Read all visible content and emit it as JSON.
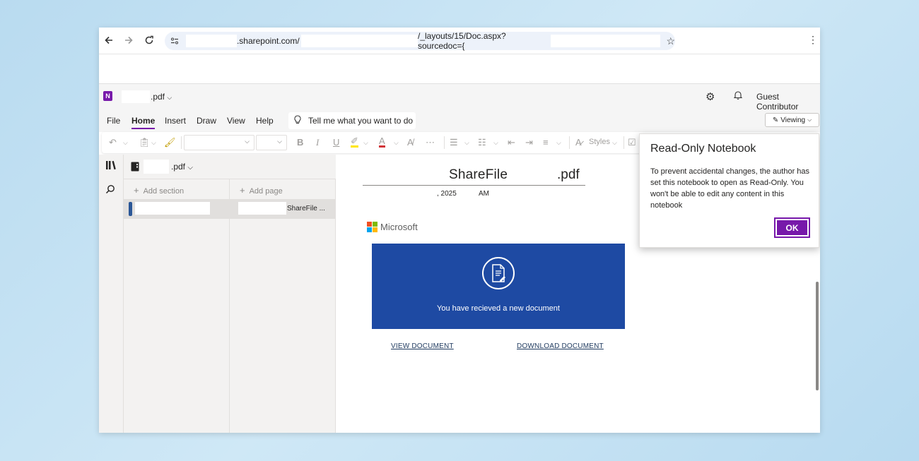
{
  "browser": {
    "url_domain": ".sharepoint.com/",
    "url_path": "/_layouts/15/Doc.aspx?sourcedoc={"
  },
  "app": {
    "logo_letter": "N",
    "doc_title": ".pdf",
    "user": "Guest Contributor"
  },
  "menu": {
    "tabs": [
      "File",
      "Home",
      "Insert",
      "Draw",
      "View",
      "Help"
    ],
    "tell_me": "Tell me what you want to do",
    "viewing": "Viewing"
  },
  "toolbar": {
    "styles_label": "Styles"
  },
  "notebook": {
    "title": ".pdf",
    "add_section": "Add section",
    "add_page": "Add page",
    "page_label": "ShareFile ..."
  },
  "page": {
    "title_main": "ShareFile",
    "title_ext": ".pdf",
    "date": ", 2025",
    "time": "AM",
    "ms_logo_text": "Microsoft",
    "banner_text": "You have recieved a new document",
    "view_link": "VIEW DOCUMENT",
    "download_link": "DOWNLOAD DOCUMENT"
  },
  "dialog": {
    "title": "Read-Only Notebook",
    "body": "To prevent accidental changes, the author has set this notebook to open as Read-Only. You won't be able to edit any content in this notebook",
    "ok": "OK"
  },
  "colors": {
    "onenote_purple": "#7719aa",
    "banner_blue": "#1e4aa3",
    "section_blue": "#2b5797"
  },
  "icons": [
    "back-icon",
    "forward-icon",
    "reload-icon",
    "site-info-icon",
    "star-icon",
    "kebab-menu-icon",
    "gear-icon",
    "bell-icon",
    "lightbulb-icon",
    "pen-icon",
    "undo-icon",
    "clipboard-icon",
    "format-painter-icon",
    "bold-icon",
    "italic-icon",
    "underline-icon",
    "highlight-icon",
    "font-color-icon",
    "clear-format-icon",
    "bullets-icon",
    "numbering-icon",
    "outdent-icon",
    "indent-icon",
    "align-icon",
    "styles-icon",
    "library-icon",
    "search-icon",
    "notebook-icon",
    "document-icon"
  ]
}
